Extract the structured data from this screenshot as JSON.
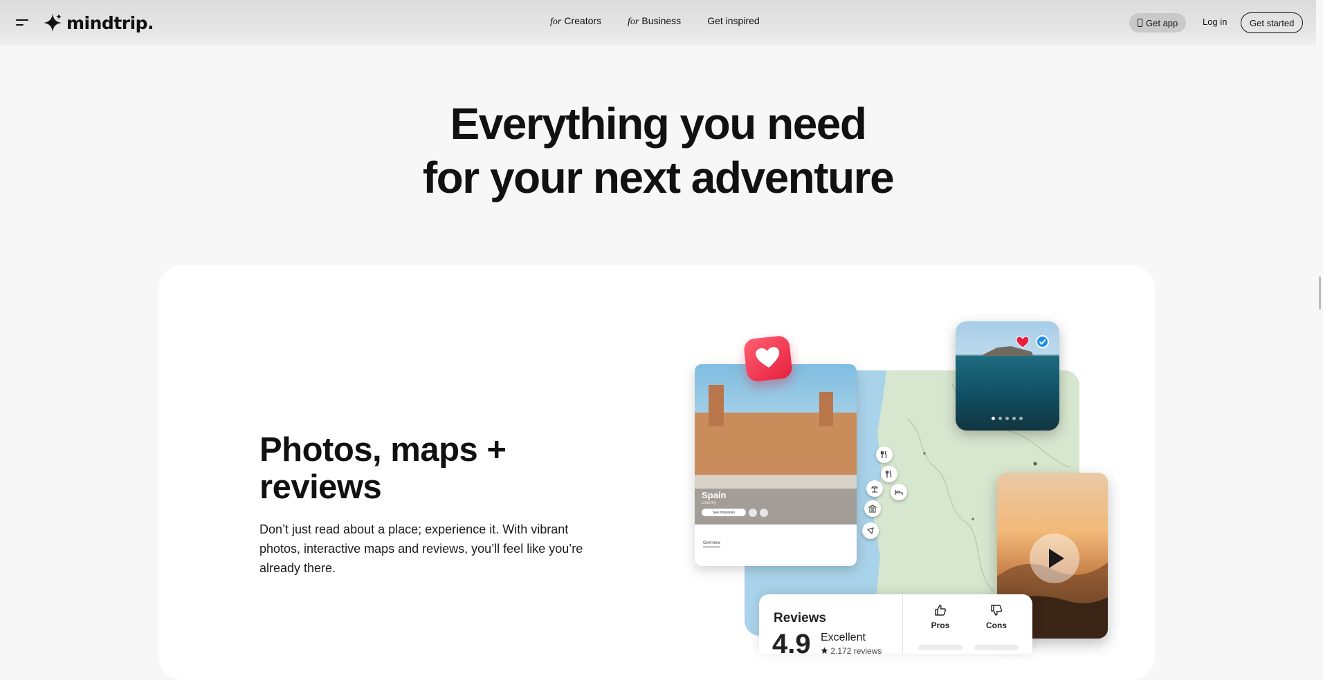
{
  "header": {
    "logo_text": "mindtrip.",
    "nav": [
      {
        "prefix": "for",
        "label": "Creators"
      },
      {
        "prefix": "for",
        "label": "Business"
      },
      {
        "prefix": "",
        "label": "Get inspired"
      }
    ],
    "get_app": "Get app",
    "login": "Log in",
    "get_started": "Get started"
  },
  "hero": {
    "line1": "Everything you need",
    "line2": "for your next adventure"
  },
  "feature": {
    "title": "Photos, maps + reviews",
    "description": "Don’t just read about a place; experience it. With vibrant photos, interactive maps and reviews, you’ll feel like you’re already there."
  },
  "place_card": {
    "name": "Spain",
    "subtitle": "Country",
    "button": "See itineraries",
    "tab": "Overview"
  },
  "reviews": {
    "title": "Reviews",
    "score": "4.9",
    "label": "Excellent",
    "count": "2,172 reviews",
    "pros": "Pros",
    "cons": "Cons"
  },
  "icons": {
    "menu": "menu-icon",
    "logo": "sparkle-icon",
    "phone": "phone-icon",
    "heart": "heart-icon",
    "check": "check-icon",
    "play": "play-icon",
    "thumbs_up": "thumbs-up-icon",
    "thumbs_down": "thumbs-down-icon"
  },
  "colors": {
    "page_bg": "#f7f7f7",
    "card_bg": "#ffffff",
    "text": "#111111",
    "heart_red": "#e6203d",
    "check_blue": "#1c8ce8",
    "map_water": "#a9d3ea",
    "map_land": "#d7e6cf"
  }
}
